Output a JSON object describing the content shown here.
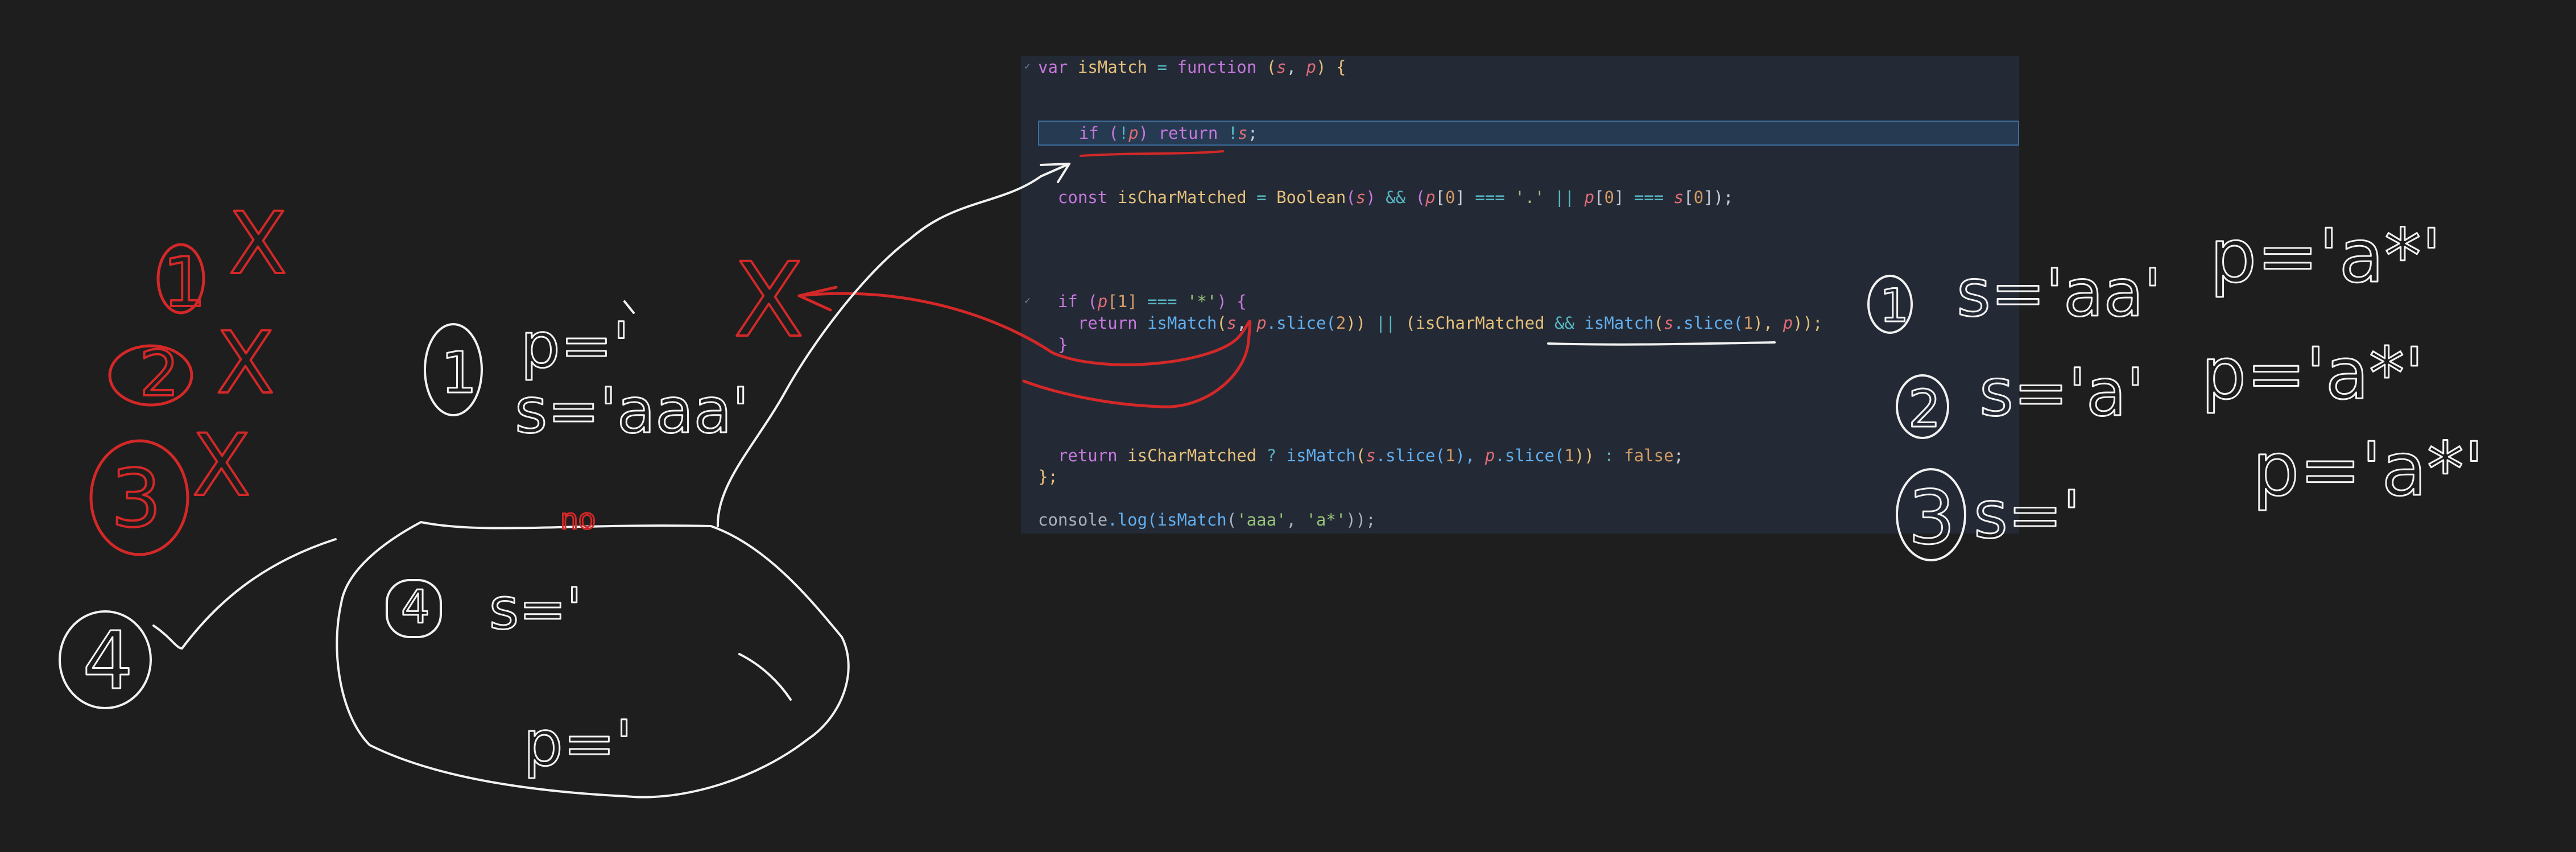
{
  "editor": {
    "lines": {
      "l1": {
        "t1": "var",
        "t2": "isMatch",
        "t3": "=",
        "t4": "function",
        "t5": "(",
        "t6": "s",
        "t7": ",",
        "t8": "p",
        "t9": ")",
        "t10": "{"
      },
      "l2": {
        "t1": "if",
        "t2": "(",
        "t3": "!",
        "t4": "p",
        "t5": ")",
        "t6": "return",
        "t7": "!",
        "t8": "s",
        "t9": ";"
      },
      "l3": {
        "t1": "const",
        "t2": "isCharMatched",
        "t3": "=",
        "t4": "Boolean",
        "t5": "(",
        "t6": "s",
        "t7": ")",
        "t8": "&&",
        "t9": "(",
        "t10": "p",
        "t11": "[",
        "t12": "0",
        "t13": "]",
        "t14": "===",
        "t15": "'.'",
        "t16": "||",
        "t17": "p",
        "t18": "[",
        "t19": "0",
        "t20": "]",
        "t21": "===",
        "t22": "s",
        "t23": "[",
        "t24": "0",
        "t25": "]",
        "t26": ");"
      },
      "l4": {
        "t1": "if",
        "t2": "(",
        "t3": "p",
        "t4": "[1]",
        "t5": "===",
        "t6": "'*'",
        "t7": ")",
        "t8": "{"
      },
      "l5": {
        "t1": "return",
        "t2": "isMatch",
        "t3": "(",
        "t4": "s",
        "t5": ",",
        "t6": "p",
        "t7": ".slice(",
        "t8": "2",
        "t9": "))",
        "t10": "||",
        "t11": "(",
        "t12": "isCharMatched",
        "t13": "&&",
        "t14": "isMatch",
        "t15": "(",
        "t16": "s",
        "t17": ".slice(",
        "t18": "1",
        "t19": "),",
        "t20": "p",
        "t21": "));"
      },
      "l6": {
        "t1": "}"
      },
      "l7": {
        "t1": "return",
        "t2": "isCharMatched",
        "t3": "?",
        "t4": "isMatch",
        "t5": "(",
        "t6": "s",
        "t7": ".slice(",
        "t8": "1",
        "t9": "),",
        "t10": "p",
        "t11": ".slice(",
        "t12": "1",
        "t13": "))",
        "t14": ":",
        "t15": "false",
        "t16": ";"
      },
      "l8": {
        "t1": "};"
      },
      "l9": {
        "t1": "console",
        "t2": ".log(",
        "t3": "isMatch",
        "t4": "(",
        "t5": "'aaa'",
        "t6": ",",
        "t7": "'a*'",
        "t8": "));"
      }
    },
    "fold_marker": "✓"
  },
  "annotations": {
    "left_red": {
      "n1": "1",
      "n2": "2",
      "n3": "3",
      "x": "X"
    },
    "top_left_case": {
      "num": "1",
      "p_label": "p='",
      "s_label": "s='aaa'"
    },
    "blob": {
      "mark": "no",
      "num": "4",
      "s_label": "s='",
      "p_label": "p='"
    },
    "circle_4": "4",
    "right_cases": {
      "c1": {
        "num": "1",
        "s": "s='aa'",
        "p": "p='a*'"
      },
      "c2": {
        "num": "2",
        "s": "s='a'",
        "p": "p='a*'"
      },
      "c3": {
        "num": "3",
        "s": "s='",
        "p": "p='a*'"
      }
    },
    "colors": {
      "red": "#d42828",
      "white": "#f2f2f2"
    }
  }
}
